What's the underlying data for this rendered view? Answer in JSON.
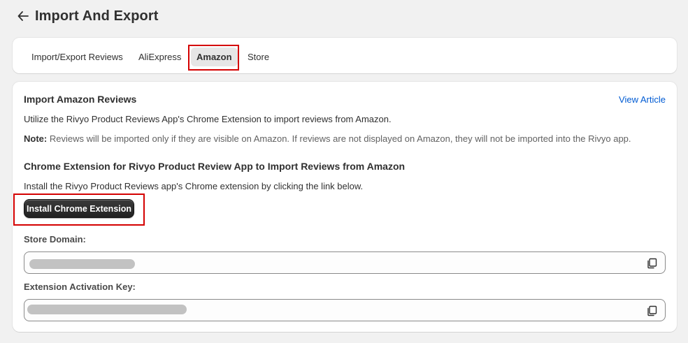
{
  "header": {
    "back_icon": "arrow-left-icon",
    "title": "Import And Export"
  },
  "tabs": [
    {
      "label": "Import/Export Reviews",
      "active": false
    },
    {
      "label": "AliExpress",
      "active": false
    },
    {
      "label": "Amazon",
      "active": true
    },
    {
      "label": "Store",
      "active": false
    }
  ],
  "main": {
    "title": "Import Amazon Reviews",
    "view_article": "View Article",
    "description": "Utilize the Rivyo Product Reviews App's Chrome Extension to import reviews from Amazon.",
    "note_label": "Note:",
    "note_text": " Reviews will be imported only if they are visible on Amazon. If reviews are not displayed on Amazon, they will not be imported into the Rivyo app.",
    "extension_title": "Chrome Extension for Rivyo Product Review App to Import Reviews from Amazon",
    "extension_description": "Install the Rivyo Product Reviews app's Chrome extension by clicking the link below.",
    "install_button": "Install Chrome Extension",
    "store_domain_label": "Store Domain:",
    "activation_key_label": "Extension Activation Key:",
    "copy_icon": "copy-icon"
  },
  "colors": {
    "accent_link": "#005bd3",
    "highlight_box": "#d40000",
    "primary_button": "#303030"
  }
}
